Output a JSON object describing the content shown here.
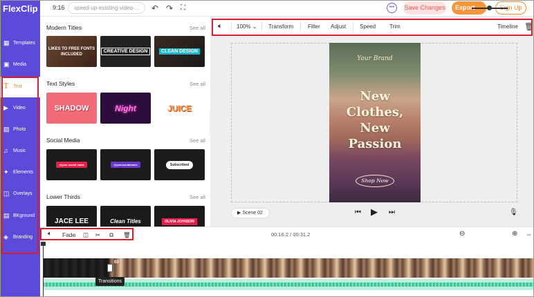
{
  "app": {
    "logo_text": "FlexClip"
  },
  "topbar": {
    "aspect_ratio": "9:16",
    "project_name": "speed-up-existing-video-...",
    "save_label": "Save Changes",
    "export_label": "Export →",
    "signup_label": "Sign Up",
    "chat_icon": "chat-icon",
    "undo_icon": "undo-icon",
    "redo_icon": "redo-icon",
    "fullscreen_icon": "fullscreen-icon"
  },
  "sidebar": {
    "items": [
      {
        "label": "Templates",
        "icon": "templates-icon",
        "active": false
      },
      {
        "label": "Media",
        "icon": "media-icon",
        "active": false
      },
      {
        "label": "Text",
        "icon": "text-icon",
        "active": true
      },
      {
        "label": "Video",
        "icon": "video-icon",
        "active": false
      },
      {
        "label": "Photo",
        "icon": "photo-icon",
        "active": false
      },
      {
        "label": "Music",
        "icon": "music-icon",
        "active": false
      },
      {
        "label": "Elements",
        "icon": "elements-icon",
        "active": false
      },
      {
        "label": "Overlays",
        "icon": "overlays-icon",
        "active": false
      },
      {
        "label": "BKground",
        "icon": "background-icon",
        "active": false
      },
      {
        "label": "Branding",
        "icon": "branding-icon",
        "active": false
      }
    ]
  },
  "library": {
    "see_all": "See all",
    "sections": [
      {
        "title": "Modern Titles",
        "thumbs": [
          "LIKES TO FREE FONTS INCLUDED",
          "CREATIVE DESIGN",
          "CLEAN DESIGN"
        ]
      },
      {
        "title": "Text Styles",
        "thumbs": [
          "SHADOW",
          "Night",
          "JUICE"
        ]
      },
      {
        "title": "Social Media",
        "thumbs": [
          "@your social name",
          "@yoursocialname",
          "Subscribed"
        ]
      },
      {
        "title": "Lower Thirds",
        "thumbs": [
          "JACE LEE",
          "Clean Titles",
          "OLIVIA JOHNSON"
        ]
      }
    ]
  },
  "toolbar": {
    "volume_icon": "volume-icon",
    "zoom": "100%",
    "transform": "Transform",
    "filter": "Filter",
    "adjust": "Adjust",
    "speed": "Speed",
    "trim": "Trim",
    "timeline": "Timeline",
    "delete_icon": "trash-icon"
  },
  "preview": {
    "brand": "Your Brand",
    "headline": [
      "New",
      "Clothes,",
      "New",
      "Passion"
    ],
    "shop": "Shop Now",
    "scene_label": "Scene  02"
  },
  "timeline": {
    "fade": "Fade",
    "time_current": "00:16.2",
    "time_total": "00:31.2",
    "time_sep": " / ",
    "clip_number": "03",
    "transitions_tooltip": "Transitions"
  },
  "colors": {
    "brand_purple": "#5b4bd8",
    "accent_orange": "#f8943a",
    "annotation_red": "#d81e2c",
    "audio_green": "#3ccf9f"
  }
}
